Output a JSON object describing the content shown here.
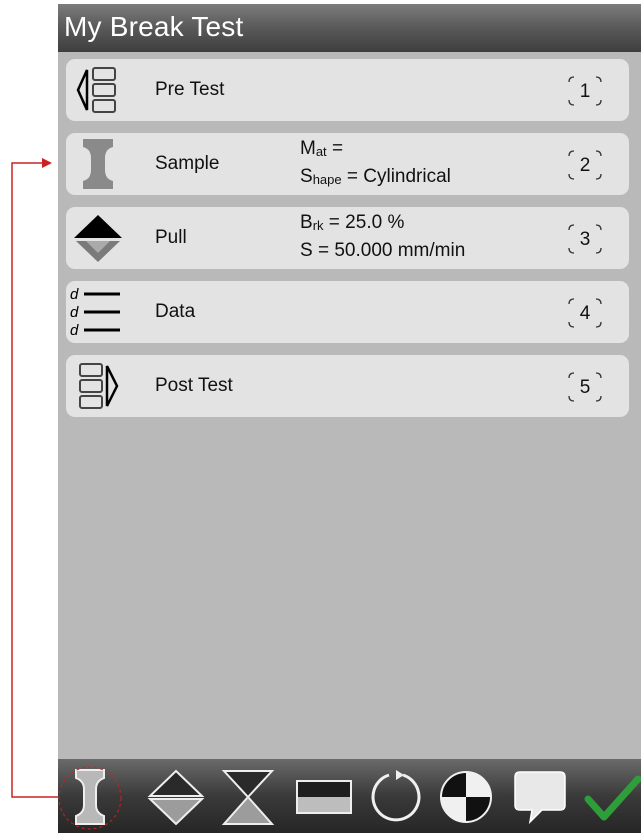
{
  "window": {
    "title": "My Break Test"
  },
  "steps": [
    {
      "label": "Pre Test",
      "number": "1",
      "icon": "pre-test-icon"
    },
    {
      "label": "Sample",
      "number": "2",
      "icon": "specimen-icon",
      "details": [
        {
          "main": "M",
          "sub": "at",
          "rest": " ="
        },
        {
          "main": "S",
          "sub": "hape",
          "rest": " = Cylindrical"
        }
      ]
    },
    {
      "label": "Pull",
      "number": "3",
      "icon": "pull-icon",
      "details": [
        {
          "main": "B",
          "sub": "rk",
          "rest": " = 25.0 %"
        },
        {
          "main": "S",
          "sub": "",
          "rest": " = 50.000 mm/min"
        }
      ]
    },
    {
      "label": "Data",
      "number": "4",
      "icon": "data-list-icon"
    },
    {
      "label": "Post Test",
      "number": "5",
      "icon": "post-test-icon"
    }
  ],
  "toolbar": {
    "tools": [
      "specimen-icon",
      "pull-icon",
      "hourglass-icon",
      "two-tone-rectangle-icon",
      "cycle-icon",
      "target-icon",
      "comment-icon",
      "checkmark-icon"
    ]
  },
  "colors": {
    "background": "#b9b9b9",
    "step_card": "#e3e3e3",
    "titlebar": "#5c5c5c",
    "toolbar": "#3a3a3a",
    "accent_arrow": "#cc2222",
    "confirm_green": "#2e9e3a"
  }
}
